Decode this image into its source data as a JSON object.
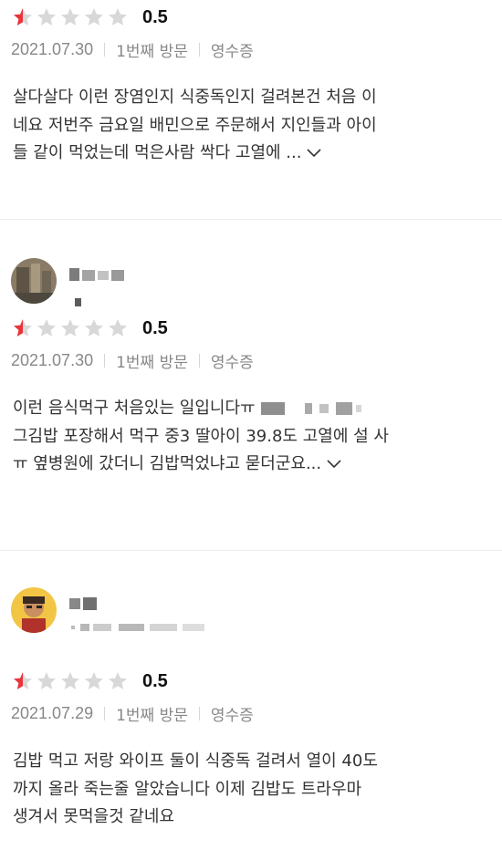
{
  "reviews": [
    {
      "rating": 0.5,
      "rating_text": "0.5",
      "date": "2021.07.30",
      "visit": "1번째 방문",
      "receipt": "영수증",
      "lines": [
        "살다살다 이런 장염인지 식중독인지 걸려본건 처음 이",
        "네요 저번주 금요일 배민으로 주문해서 지인들과 아이",
        "들 같이 먹었는데 먹은사람 싹다 고열에 ..."
      ]
    },
    {
      "rating": 0.5,
      "rating_text": "0.5",
      "date": "2021.07.30",
      "visit": "1번째 방문",
      "receipt": "영수증",
      "lines": [
        "이런 음식먹구 처음있는 일입니다ㅠ",
        "그김밥 포장해서 먹구 중3 딸아이 39.8도 고열에 설 사",
        "ㅠ 옆병원에 갔더니 김밥먹었냐고 묻더군요..."
      ]
    },
    {
      "rating": 0.5,
      "rating_text": "0.5",
      "date": "2021.07.29",
      "visit": "1번째 방문",
      "receipt": "영수증",
      "lines": [
        "김밥 먹고 저랑 와이프 둘이 식중독 걸려서 열이 40도",
        "까지 올라 죽는줄 알았습니다 이제 김밥도 트라우마",
        "생겨서 못먹을것 같네요"
      ]
    }
  ],
  "colors": {
    "star_filled": "#e8343a",
    "star_empty": "#d8d8d8",
    "meta": "#888888"
  },
  "icons": {
    "star": "star-icon",
    "expand": "chevron-down-icon"
  }
}
